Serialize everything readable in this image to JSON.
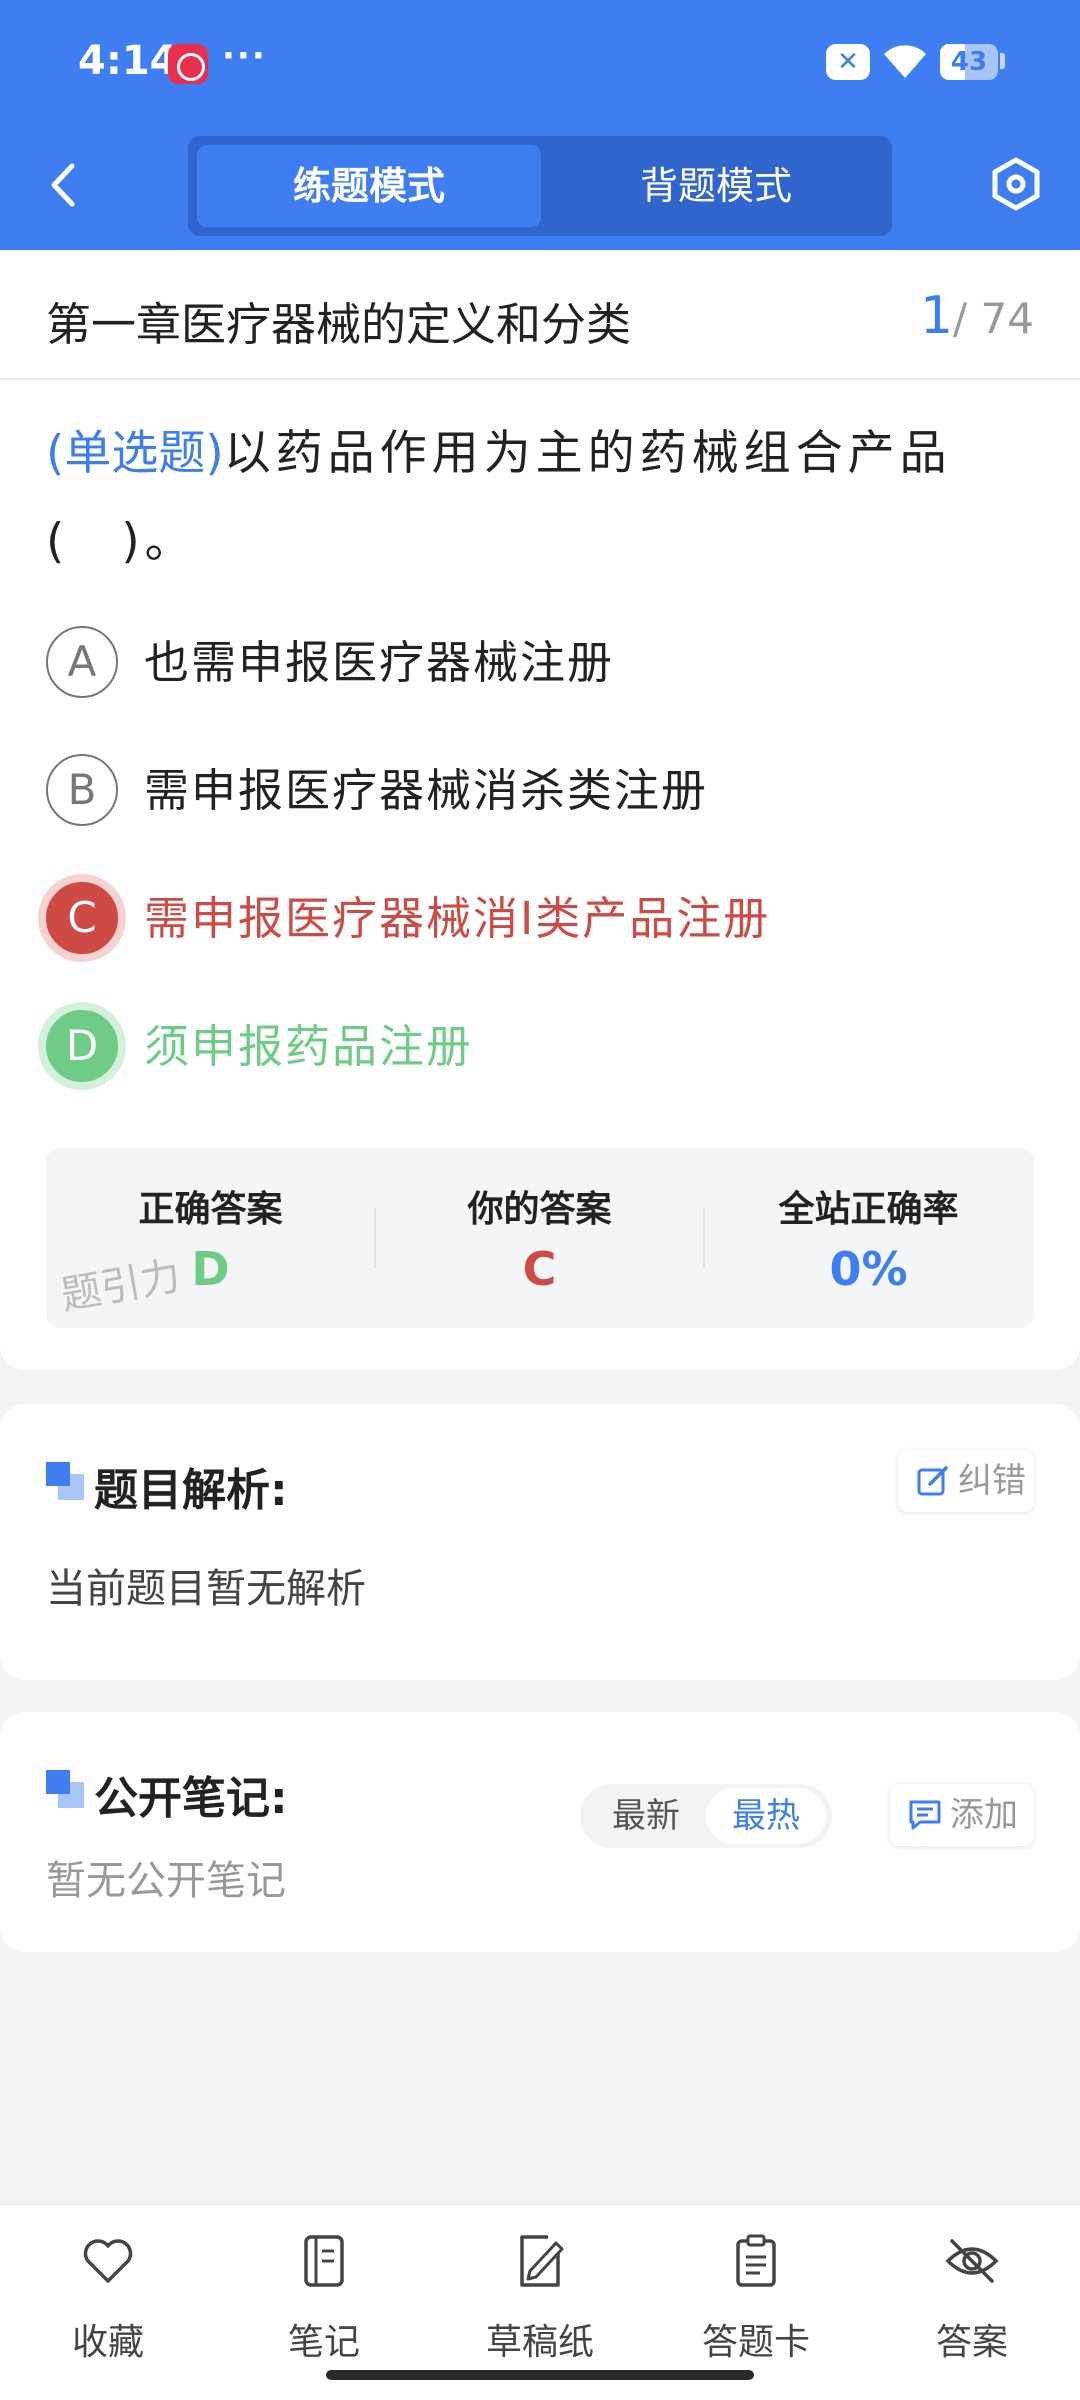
{
  "status_bar": {
    "time": "4:14",
    "dots": "···",
    "battery": "43"
  },
  "header": {
    "tabs": [
      {
        "label": "练题模式",
        "active": true
      },
      {
        "label": "背题模式",
        "active": false
      }
    ],
    "back_icon": "chevron-left-icon",
    "settings_icon": "hexagon-settings-icon"
  },
  "question_card": {
    "chapter_title": "第一章医疗器械的定义和分类",
    "counter_current": "1",
    "counter_total": "/ 74",
    "question_type": "(单选题)",
    "question_text": "以药品作用为主的药械组合产品(　)。",
    "options": [
      {
        "letter": "A",
        "text": "也需申报医疗器械注册",
        "state": "normal"
      },
      {
        "letter": "B",
        "text": "需申报医疗器械消杀类注册",
        "state": "normal"
      },
      {
        "letter": "C",
        "text": "需申报医疗器械消Ⅰ类产品注册",
        "state": "wrong"
      },
      {
        "letter": "D",
        "text": "须申报药品注册",
        "state": "correct"
      }
    ],
    "answer_summary": {
      "correct_label": "正确答案",
      "correct_value": "D",
      "yours_label": "你的答案",
      "yours_value": "C",
      "rate_label": "全站正确率",
      "rate_value": "0%"
    },
    "watermark": "题引力"
  },
  "analysis": {
    "title": "题目解析:",
    "report_button": "纠错",
    "body": "当前题目暂无解析"
  },
  "notes": {
    "title": "公开笔记:",
    "sort_options": [
      "最新",
      "最热"
    ],
    "sort_selected": "最热",
    "add_button": "添加",
    "body": "暂无公开笔记"
  },
  "bottom_nav": [
    {
      "label": "收藏",
      "icon": "heart-icon"
    },
    {
      "label": "笔记",
      "icon": "notebook-icon"
    },
    {
      "label": "草稿纸",
      "icon": "draft-paper-icon"
    },
    {
      "label": "答题卡",
      "icon": "answer-sheet-icon"
    },
    {
      "label": "答案",
      "icon": "eye-off-icon"
    }
  ],
  "colors": {
    "brand_blue": "#3e7ef0",
    "wrong_red": "#cd4a45",
    "correct_green": "#6ecc87"
  }
}
